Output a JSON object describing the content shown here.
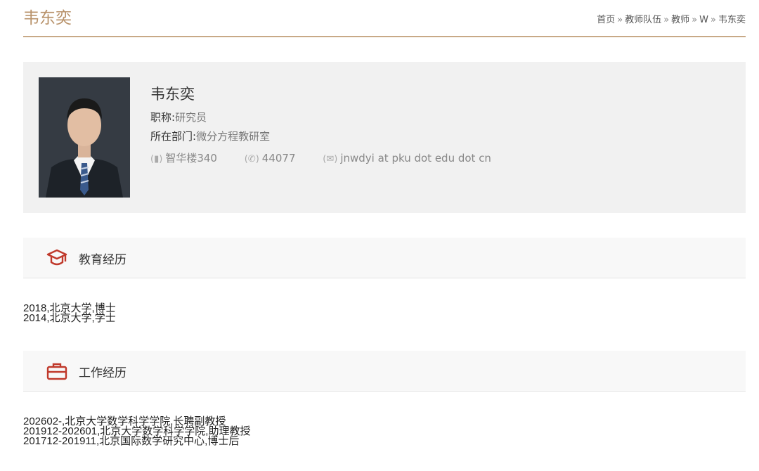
{
  "page": {
    "title": "韦东奕"
  },
  "breadcrumb": {
    "items": [
      "首页",
      "教师队伍",
      "教师",
      "W",
      "韦东奕"
    ],
    "separator": "»"
  },
  "profile": {
    "name": "韦东奕",
    "title_label": "职称:",
    "title_value": "研究员",
    "dept_label": "所在部门:",
    "dept_value": "微分方程教研室",
    "office": "智华楼340",
    "phone": "44077",
    "email": "jnwdyi at pku dot edu dot cn"
  },
  "education": {
    "heading": "教育经历",
    "icon": "graduation-cap-icon",
    "entries": [
      "2018,北京大学,博士",
      "2014,北京大学,学士"
    ]
  },
  "work": {
    "heading": "工作经历",
    "icon": "briefcase-icon",
    "entries": [
      "202602-,北京大学数学科学学院,长聘副教授",
      "201912-202601,北京大学数学科学学院,助理教授",
      "201712-201911,北京国际数学研究中心,博士后"
    ]
  },
  "colors": {
    "accent": "#b8926a",
    "icon_red": "#c0392b",
    "card_bg": "#f1f1f1"
  }
}
